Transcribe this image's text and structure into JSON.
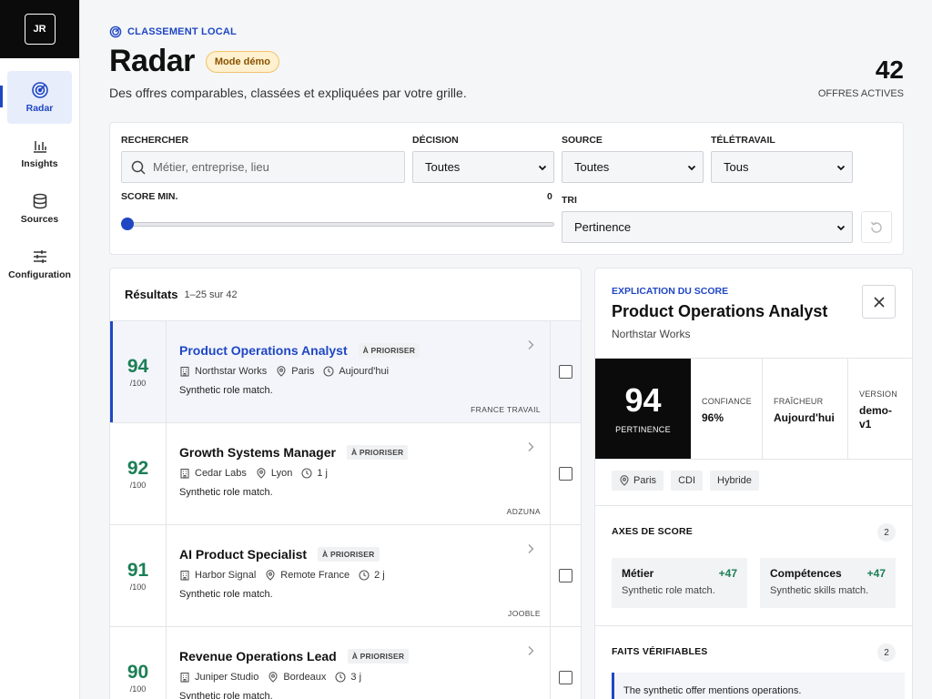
{
  "user": {
    "initials": "JR"
  },
  "nav": [
    {
      "label": "Radar",
      "icon": "radar-icon",
      "active": true
    },
    {
      "label": "Insights",
      "icon": "bar-chart-icon"
    },
    {
      "label": "Sources",
      "icon": "database-icon"
    },
    {
      "label": "Configuration",
      "icon": "sliders-icon"
    }
  ],
  "header": {
    "eyebrow": "CLASSEMENT LOCAL",
    "title": "Radar",
    "badge": "Mode démo",
    "subtitle": "Des offres comparables, classées et expliquées par votre grille.",
    "stat_value": "42",
    "stat_label": "OFFRES ACTIVES"
  },
  "filters": {
    "search_label": "RECHERCHER",
    "search_placeholder": "Métier, entreprise, lieu",
    "search_value": "",
    "decision_label": "DÉCISION",
    "decision_value": "Toutes",
    "source_label": "SOURCE",
    "source_value": "Toutes",
    "remote_label": "TÉLÉTRAVAIL",
    "remote_value": "Tous",
    "score_label": "SCORE MIN.",
    "score_value": "0",
    "sort_label": "TRI",
    "sort_value": "Pertinence"
  },
  "results": {
    "title": "Résultats",
    "count": "1–25 sur 42",
    "items": [
      {
        "score": "94",
        "max": "/100",
        "title": "Product Operations Analyst",
        "tag": "À PRIORISER",
        "company": "Northstar Works",
        "location": "Paris",
        "date": "Aujourd'hui",
        "desc": "Synthetic role match.",
        "source": "FRANCE TRAVAIL"
      },
      {
        "score": "92",
        "max": "/100",
        "title": "Growth Systems Manager",
        "tag": "À PRIORISER",
        "company": "Cedar Labs",
        "location": "Lyon",
        "date": "1 j",
        "desc": "Synthetic role match.",
        "source": "ADZUNA"
      },
      {
        "score": "91",
        "max": "/100",
        "title": "AI Product Specialist",
        "tag": "À PRIORISER",
        "company": "Harbor Signal",
        "location": "Remote France",
        "date": "2 j",
        "desc": "Synthetic role match.",
        "source": "JOOBLE"
      },
      {
        "score": "90",
        "max": "/100",
        "title": "Revenue Operations Lead",
        "tag": "À PRIORISER",
        "company": "Juniper Studio",
        "location": "Bordeaux",
        "date": "3 j",
        "desc": "Synthetic role match.",
        "source": ""
      }
    ]
  },
  "detail": {
    "eyebrow": "EXPLICATION DU SCORE",
    "title": "Product Operations Analyst",
    "company": "Northstar Works",
    "score": "94",
    "score_label": "PERTINENCE",
    "confidence_label": "CONFIANCE",
    "confidence_value": "96%",
    "freshness_label": "FRAÎCHEUR",
    "freshness_value": "Aujourd'hui",
    "version_label": "VERSION",
    "version_value": "demo-v1",
    "chips": [
      "Paris",
      "CDI",
      "Hybride"
    ],
    "axes_title": "AXES DE SCORE",
    "axes_count": "2",
    "axes": [
      {
        "name": "Métier",
        "value": "+47",
        "desc": "Synthetic role match."
      },
      {
        "name": "Compétences",
        "value": "+47",
        "desc": "Synthetic skills match."
      }
    ],
    "facts_title": "FAITS VÉRIFIABLES",
    "facts_count": "2",
    "facts": [
      "The synthetic offer mentions operations."
    ]
  },
  "colors": {
    "accent": "#1f47c4",
    "score_green": "#1b7f55",
    "demo_bg": "#fff1cf",
    "dark": "#0b0b0b"
  }
}
